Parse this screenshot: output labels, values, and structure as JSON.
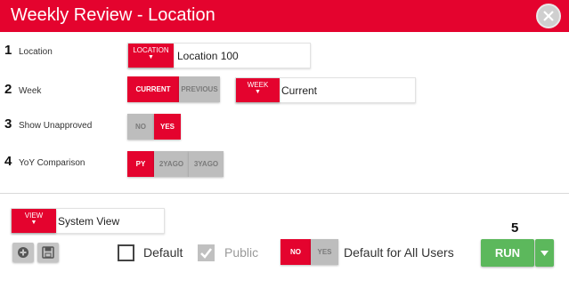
{
  "window": {
    "title": "Weekly Review - Location"
  },
  "rows": [
    {
      "number": "1",
      "label": "Location"
    },
    {
      "number": "2",
      "label": "Week"
    },
    {
      "number": "3",
      "label": "Show Unapproved"
    },
    {
      "number": "4",
      "label": "YoY Comparison"
    }
  ],
  "location": {
    "tag": "LOCATION",
    "value": "Location 100"
  },
  "week": {
    "options": [
      "CURRENT",
      "PREVIOUS"
    ],
    "selected": "CURRENT",
    "tag": "WEEK",
    "value": "Current"
  },
  "unapproved": {
    "options": [
      "NO",
      "YES"
    ],
    "selected": "YES"
  },
  "yoy": {
    "options": [
      "PY",
      "2YAGO",
      "3YAGO"
    ],
    "selected": "PY"
  },
  "view": {
    "tag": "VIEW",
    "value": "System View"
  },
  "footer": {
    "default_label": "Default",
    "default_checked": false,
    "public_label": "Public",
    "public_checked": true,
    "all_users": {
      "options": [
        "NO",
        "YES"
      ],
      "selected": "NO",
      "label": "Default for All Users"
    },
    "run_number": "5",
    "run_label": "RUN"
  },
  "colors": {
    "accent": "#e4032e",
    "run": "#5cb85c",
    "inactive": "#bdbdbd"
  },
  "icons": [
    "close-icon",
    "caret-down-icon",
    "add-icon",
    "save-icon",
    "check-icon"
  ]
}
